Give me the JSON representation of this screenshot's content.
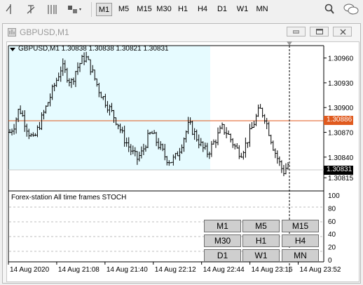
{
  "toolbar": {
    "icons": [
      "crosshair-icon",
      "text-tool-icon",
      "fibonacci-icon",
      "shapes-tool-icon",
      "search-icon",
      "chat-icon"
    ],
    "timeframes": [
      {
        "label": "M1",
        "active": true
      },
      {
        "label": "M5",
        "active": false
      },
      {
        "label": "M15",
        "active": false
      },
      {
        "label": "M30",
        "active": false
      },
      {
        "label": "H1",
        "active": false
      },
      {
        "label": "H4",
        "active": false
      },
      {
        "label": "D1",
        "active": false
      },
      {
        "label": "W1",
        "active": false
      },
      {
        "label": "MN",
        "active": false
      }
    ]
  },
  "window": {
    "title": "GBPUSD,M1",
    "icons": [
      "chart-window-icon",
      "minimize-icon",
      "restore-icon",
      "close-icon"
    ]
  },
  "chart": {
    "header": "GBPUSD,M1  1.30838 1.30838 1.30821 1.30831",
    "indicator_label": "Forex-station  All time frames STOCH",
    "price_badges": {
      "resistance": "1.30886",
      "current": "1.30831"
    },
    "colors": {
      "highlight": "#e6fbff",
      "resistance_line": "#e05a1e",
      "candles": "#000000",
      "badge_bg": "#000000",
      "badge_resistance_bg": "#e05a1e"
    },
    "tf_buttons": [
      [
        "M1",
        "M5",
        "M15"
      ],
      [
        "M30",
        "H1",
        "H4"
      ],
      [
        "D1",
        "W1",
        "MN"
      ]
    ]
  },
  "chart_data": {
    "type": "candlestick",
    "symbol": "GBPUSD",
    "timeframe": "M1",
    "price_axis_ticks": [
      "1.30960",
      "1.30930",
      "1.30900",
      "1.30870",
      "1.30840",
      "1.30815"
    ],
    "indicator_axis_ticks": [
      "100",
      "80",
      "60",
      "40",
      "20",
      "0"
    ],
    "time_axis_ticks": [
      "14 Aug 2020",
      "14 Aug 21:08",
      "14 Aug 21:40",
      "14 Aug 22:12",
      "14 Aug 22:44",
      "14 Aug 23:16",
      "14 Aug 23:52"
    ],
    "ylim": [
      1.30805,
      1.30975
    ],
    "close_path": [
      1.3087,
      1.3088,
      1.309,
      1.30885,
      1.3087,
      1.3086,
      1.30875,
      1.3089,
      1.30905,
      1.3092,
      1.30935,
      1.3095,
      1.3094,
      1.3093,
      1.30945,
      1.30955,
      1.30962,
      1.3095,
      1.30935,
      1.3092,
      1.3091,
      1.309,
      1.3089,
      1.3088,
      1.30865,
      1.30855,
      1.30845,
      1.30838,
      1.30845,
      1.3086,
      1.3087,
      1.3086,
      1.3085,
      1.3084,
      1.30835,
      1.30838,
      1.3085,
      1.30865,
      1.3088,
      1.3087,
      1.3086,
      1.3085,
      1.30845,
      1.30855,
      1.30865,
      1.30875,
      1.3087,
      1.3086,
      1.3085,
      1.30845,
      1.30855,
      1.3087,
      1.30885,
      1.30898,
      1.3089,
      1.3087,
      1.3085,
      1.30835,
      1.30822,
      1.30831
    ]
  }
}
